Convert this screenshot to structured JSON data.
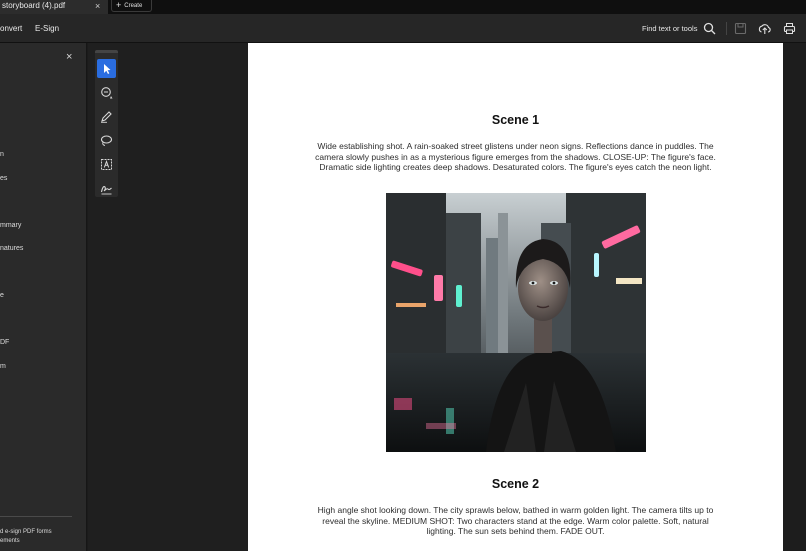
{
  "tabs": {
    "active_label": "storyboard (4).pdf",
    "close_glyph": "×",
    "create_label": "Create"
  },
  "menu": {
    "convert": "onvert",
    "esign": "E-Sign"
  },
  "search": {
    "label": "Find text or tools"
  },
  "left_panel": {
    "close_glyph": "×",
    "items": [
      "n",
      "es",
      "mmary",
      "natures",
      "e",
      "DF",
      "m"
    ],
    "footer_line1": "d e-sign PDF forms",
    "footer_line2": "ements"
  },
  "tools": [
    "select-tool",
    "comment-tool",
    "draw-tool",
    "lasso-tool",
    "text-tool",
    "sign-tool"
  ],
  "document": {
    "scene1_title": "Scene 1",
    "scene1_text": "Wide establishing shot. A rain-soaked street glistens under neon signs. Reflections dance in puddles. The camera slowly pushes in as a mysterious figure emerges from the shadows. CLOSE-UP: The figure's face. Dramatic side lighting creates deep shadows. Desaturated colors. The figure's eyes catch the neon light.",
    "scene2_title": "Scene 2",
    "scene2_text": "High angle shot looking down. The city sprawls below, bathed in warm golden light. The camera tilts up to reveal the skyline. MEDIUM SHOT: Two characters stand at the edge. Warm color palette. Soft, natural lighting. The sun sets behind them. FADE OUT."
  },
  "colors": {
    "accent": "#2a6de0",
    "neon_pink": "#ff4f8b",
    "neon_teal": "#5ff0d0"
  }
}
